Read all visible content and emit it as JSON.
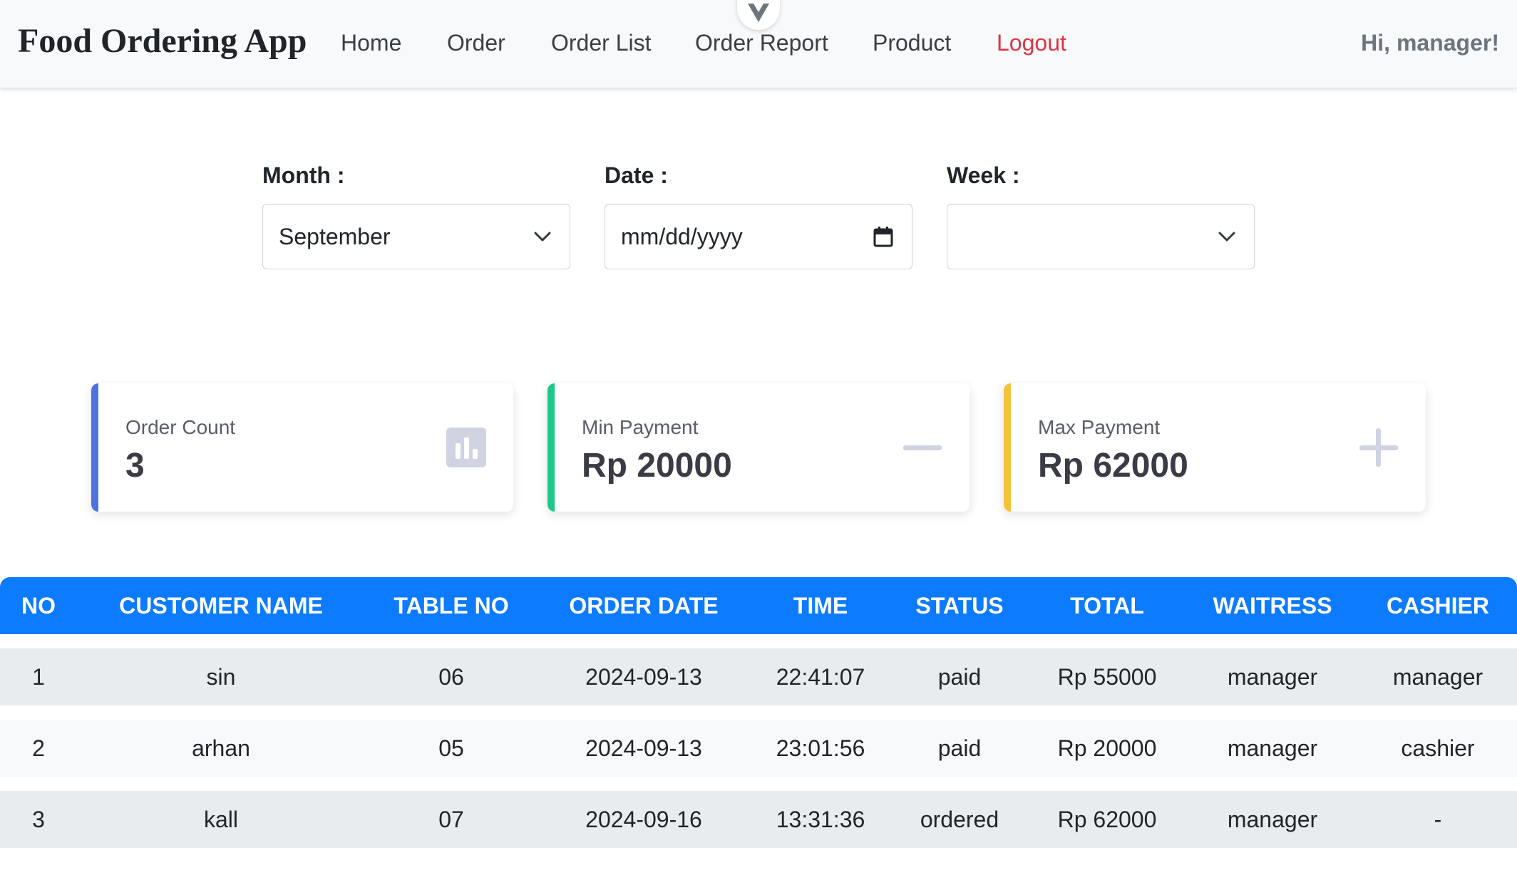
{
  "app": {
    "brand": "Food Ordering App"
  },
  "nav": {
    "home": "Home",
    "order": "Order",
    "order_list": "Order List",
    "order_report": "Order Report",
    "product": "Product",
    "logout": "Logout",
    "greeting": "Hi, manager!"
  },
  "filters": {
    "month_label": "Month :",
    "month_value": "September",
    "date_label": "Date :",
    "date_placeholder": "mm/dd/yyyy",
    "week_label": "Week :",
    "week_value": ""
  },
  "stats": {
    "order_count_label": "Order Count",
    "order_count_value": "3",
    "min_payment_label": "Min Payment",
    "min_payment_value": "Rp 20000",
    "max_payment_label": "Max Payment",
    "max_payment_value": "Rp 62000"
  },
  "colors": {
    "accent_blue": "#0d7bff",
    "card_blue": "#4e73df",
    "card_green": "#1cc88a",
    "card_yellow": "#f6c23e",
    "logout_red": "#dc3545"
  },
  "table": {
    "headers": [
      "NO",
      "CUSTOMER NAME",
      "TABLE NO",
      "ORDER DATE",
      "TIME",
      "STATUS",
      "TOTAL",
      "WAITRESS",
      "CASHIER"
    ],
    "rows": [
      [
        "1",
        "sin",
        "06",
        "2024-09-13",
        "22:41:07",
        "paid",
        "Rp 55000",
        "manager",
        "manager"
      ],
      [
        "2",
        "arhan",
        "05",
        "2024-09-13",
        "23:01:56",
        "paid",
        "Rp 20000",
        "manager",
        "cashier"
      ],
      [
        "3",
        "kall",
        "07",
        "2024-09-16",
        "13:31:36",
        "ordered",
        "Rp 62000",
        "manager",
        "-"
      ]
    ]
  }
}
